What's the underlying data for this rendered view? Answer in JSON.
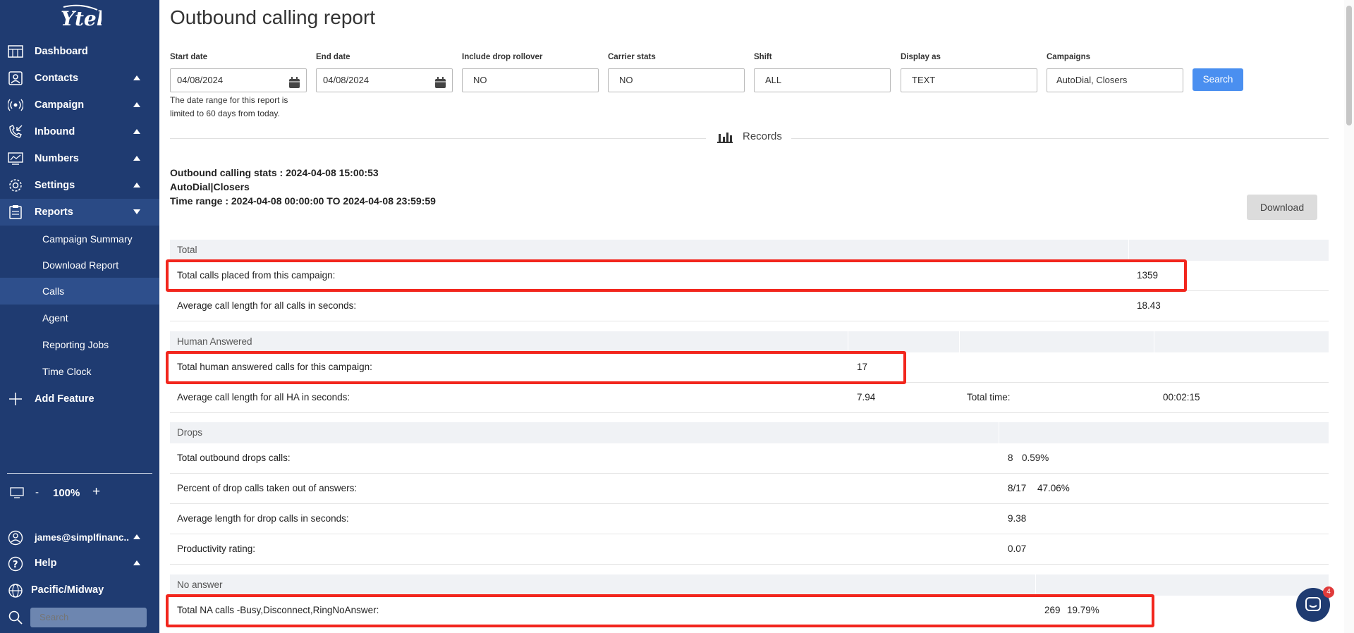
{
  "app": {
    "logo_text": "Ytel"
  },
  "sidebar": {
    "nav": [
      {
        "label": "Dashboard",
        "icon": "dashboard-icon"
      },
      {
        "label": "Contacts",
        "icon": "contacts-icon"
      },
      {
        "label": "Campaign",
        "icon": "broadcast-icon"
      },
      {
        "label": "Inbound",
        "icon": "phone-incoming-icon"
      },
      {
        "label": "Numbers",
        "icon": "numbers-icon"
      },
      {
        "label": "Settings",
        "icon": "gear-icon"
      },
      {
        "label": "Reports",
        "icon": "clipboard-icon"
      }
    ],
    "sub_items": [
      "Campaign Summary",
      "Download Report",
      "Calls",
      "Agent",
      "Reporting Jobs",
      "Time Clock"
    ],
    "add_feature": "Add Feature",
    "zoom": {
      "minus": "-",
      "value": "100%",
      "plus": "+"
    },
    "user": "james@simplfinanc..",
    "help": "Help",
    "timezone": "Pacific/Midway",
    "search_placeholder": "Search"
  },
  "header": {
    "title": "Outbound calling report"
  },
  "filters": {
    "start_date": {
      "label": "Start date",
      "value": "04/08/2024"
    },
    "end_date": {
      "label": "End date",
      "value": "04/08/2024"
    },
    "drop_rollover": {
      "label": "Include drop rollover",
      "value": "NO"
    },
    "carrier_stats": {
      "label": "Carrier stats",
      "value": "NO"
    },
    "shift": {
      "label": "Shift",
      "value": "ALL"
    },
    "display_as": {
      "label": "Display as",
      "value": "TEXT"
    },
    "campaigns": {
      "label": "Campaigns",
      "value": "AutoDial, Closers"
    },
    "search_button": "Search",
    "hint_line1": "The date range for this report is",
    "hint_line2": "limited to 60 days from today."
  },
  "records": {
    "label": "Records"
  },
  "stats": {
    "line1": "Outbound calling stats : 2024-04-08 15:00:53",
    "line2": "AutoDial|Closers",
    "line3": "Time range : 2024-04-08 00:00:00 TO 2024-04-08 23:59:59",
    "download": "Download"
  },
  "total": {
    "header": "Total",
    "placed_label": "Total calls placed from this campaign:",
    "placed_value": "1359",
    "avg_label": "Average call length for all calls in seconds:",
    "avg_value": "18.43"
  },
  "human": {
    "header": "Human Answered",
    "total_label": "Total human answered calls for this campaign:",
    "total_value": "17",
    "avg_label": "Average call length for all HA in seconds:",
    "avg_value": "7.94",
    "time_label": "Total time:",
    "time_value": "00:02:15"
  },
  "drops": {
    "header": "Drops",
    "rows": [
      {
        "label": "Total outbound drops calls:",
        "value": "8",
        "pct": "0.59%"
      },
      {
        "label": "Percent of drop calls taken out of answers:",
        "value": "8/17",
        "pct": "47.06%"
      },
      {
        "label": "Average length for drop calls in seconds:",
        "value": "9.38",
        "pct": ""
      },
      {
        "label": "Productivity rating:",
        "value": "0.07",
        "pct": ""
      }
    ]
  },
  "no_answer": {
    "header": "No answer",
    "label": "Total NA calls -Busy,Disconnect,RingNoAnswer:",
    "value": "269",
    "pct": "19.79%"
  },
  "chat": {
    "badge": "4"
  },
  "colors": {
    "sidebar": "#1f3b71",
    "accent": "#4a8ff0",
    "highlight": "#f2261d"
  }
}
